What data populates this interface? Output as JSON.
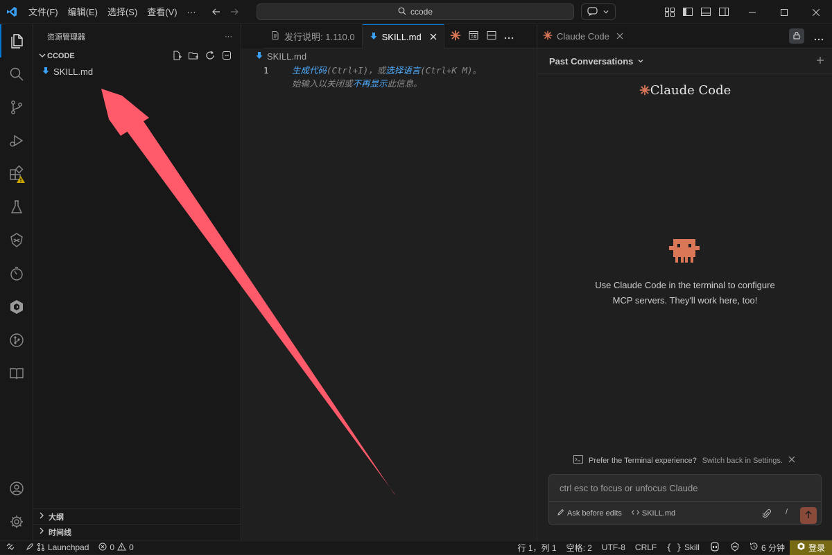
{
  "titlebar": {
    "menu": [
      "文件(F)",
      "编辑(E)",
      "选择(S)",
      "查看(V)",
      "···"
    ],
    "search": "ccode"
  },
  "sidebar": {
    "title": "资源管理器",
    "more": "···",
    "folder": "CCODE",
    "files": [
      "SKILL.md"
    ],
    "sections": [
      "大纲",
      "时间线"
    ]
  },
  "editor": {
    "tabs": [
      "发行说明: 1.110.0",
      "SKILL.md"
    ],
    "breadcrumb": "SKILL.md",
    "line_number": "1",
    "hint_line1": {
      "a": "生成代码",
      "b": "(Ctrl+I)，或",
      "c": "选择语言",
      "d": "(Ctrl+K M)。"
    },
    "hint_line2": {
      "a": "始输入以关闭或",
      "b": "不再显示",
      "c": "此信息。"
    }
  },
  "panel": {
    "tab": "Claude Code",
    "header": "Past Conversations",
    "brand": "Claude Code",
    "message_line1": "Use Claude Code in the terminal to configure",
    "message_line2": "MCP servers. They'll work here, too!",
    "terminal_hint": "Prefer the Terminal experience?",
    "terminal_link": "Switch back in Settings.",
    "input_placeholder": "ctrl esc to focus or unfocus Claude",
    "ask_label": "Ask before edits",
    "file_chip": "SKILL.md",
    "slash": "/"
  },
  "statusbar": {
    "launchpad": "Launchpad",
    "errors": "0",
    "warnings": "0",
    "position": "行 1，列 1",
    "spaces": "空格: 2",
    "encoding": "UTF-8",
    "eol": "CRLF",
    "language": "Skill",
    "time": "6 分钟",
    "signin": "登录"
  },
  "colors": {
    "accent": "#0078d4",
    "claude_orange": "#d97757",
    "annotation_arrow": "#ff5a6a"
  }
}
